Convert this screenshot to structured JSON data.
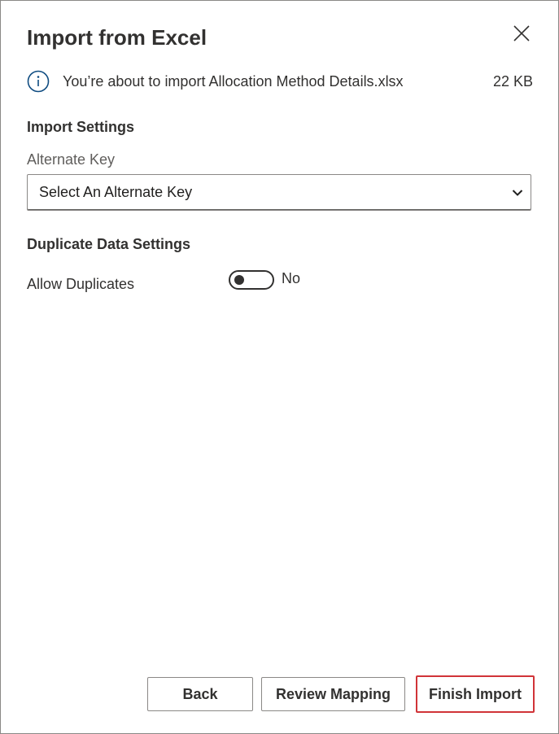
{
  "dialog": {
    "title": "Import from Excel",
    "close_icon": "close-icon"
  },
  "info": {
    "icon": "info-icon",
    "message": "You’re about to import Allocation Method Details.xlsx",
    "file_size": "22 KB"
  },
  "import_settings": {
    "heading": "Import Settings",
    "alternate_key_label": "Alternate Key",
    "alternate_key_value": "Select An Alternate Key",
    "chevron_icon": "chevron-down-icon"
  },
  "duplicate_settings": {
    "heading": "Duplicate Data Settings",
    "allow_duplicates_label": "Allow Duplicates",
    "allow_duplicates_on": false,
    "allow_duplicates_state": "No"
  },
  "footer": {
    "back_label": "Back",
    "review_mapping_label": "Review Mapping",
    "finish_import_label": "Finish Import",
    "highlight_color": "#d13438"
  }
}
